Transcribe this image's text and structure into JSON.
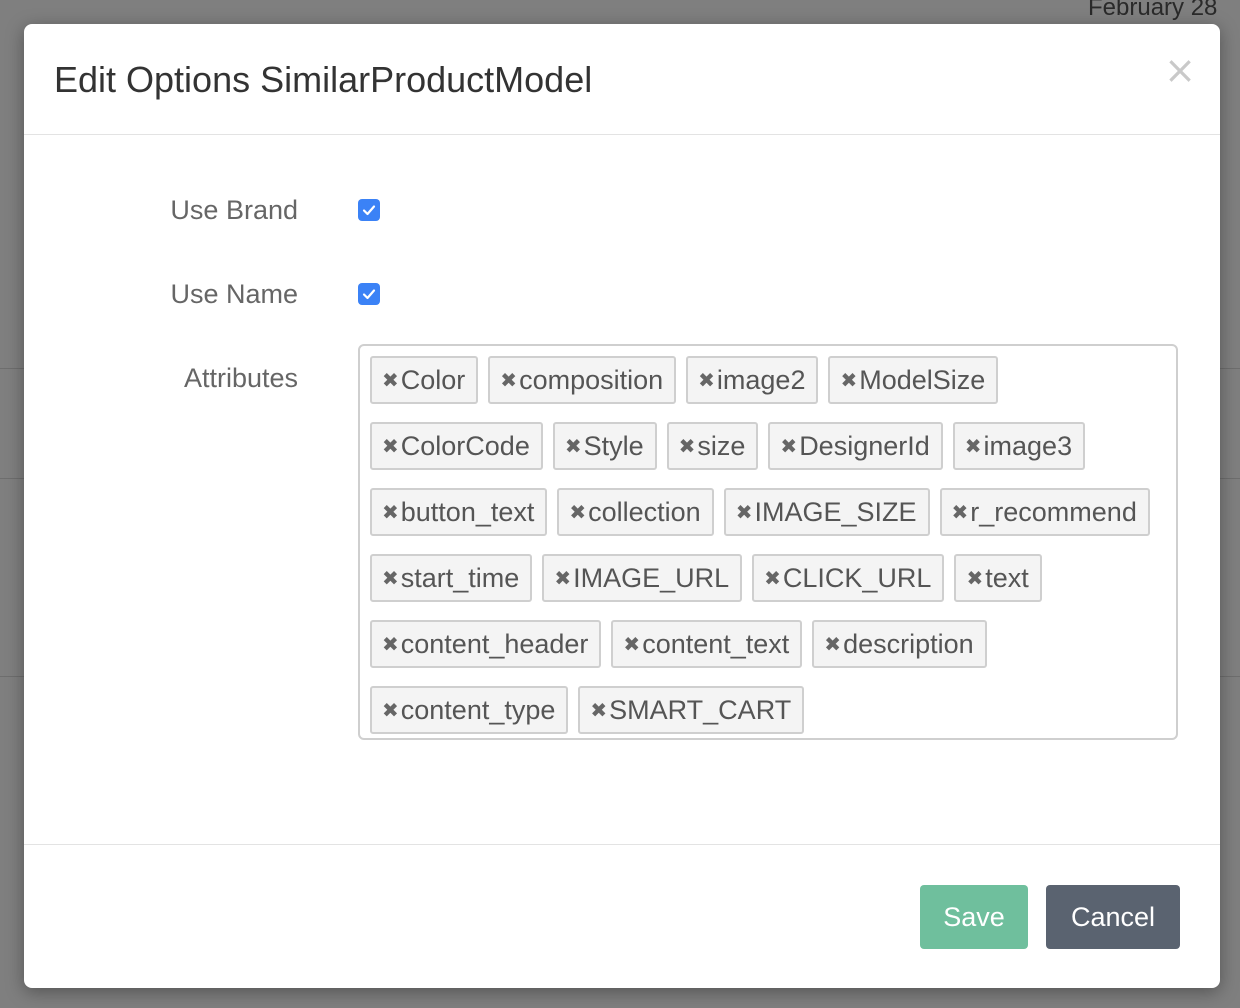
{
  "modal": {
    "title": "Edit Options SimilarProductModel",
    "close_glyph": "×"
  },
  "form": {
    "use_brand": {
      "label": "Use Brand",
      "checked": true
    },
    "use_name": {
      "label": "Use Name",
      "checked": true
    },
    "attributes": {
      "label": "Attributes",
      "remove_glyph": "✖",
      "tags": [
        "Color",
        "composition",
        "image2",
        "ModelSize",
        "ColorCode",
        "Style",
        "size",
        "DesignerId",
        "image3",
        "button_text",
        "collection",
        "IMAGE_SIZE",
        "r_recommend",
        "start_time",
        "IMAGE_URL",
        "CLICK_URL",
        "text",
        "content_header",
        "content_text",
        "description",
        "content_type",
        "SMART_CART"
      ]
    }
  },
  "footer": {
    "save_label": "Save",
    "cancel_label": "Cancel"
  },
  "background": {
    "date_label": "February 28"
  },
  "colors": {
    "checkbox": "#3b82f6",
    "save_button": "#6fbf9d",
    "cancel_button": "#5a6370",
    "overlay": "rgba(0,0,0,0.5)"
  },
  "icons": [
    "close-icon",
    "checkmark-icon",
    "remove-tag-icon"
  ]
}
